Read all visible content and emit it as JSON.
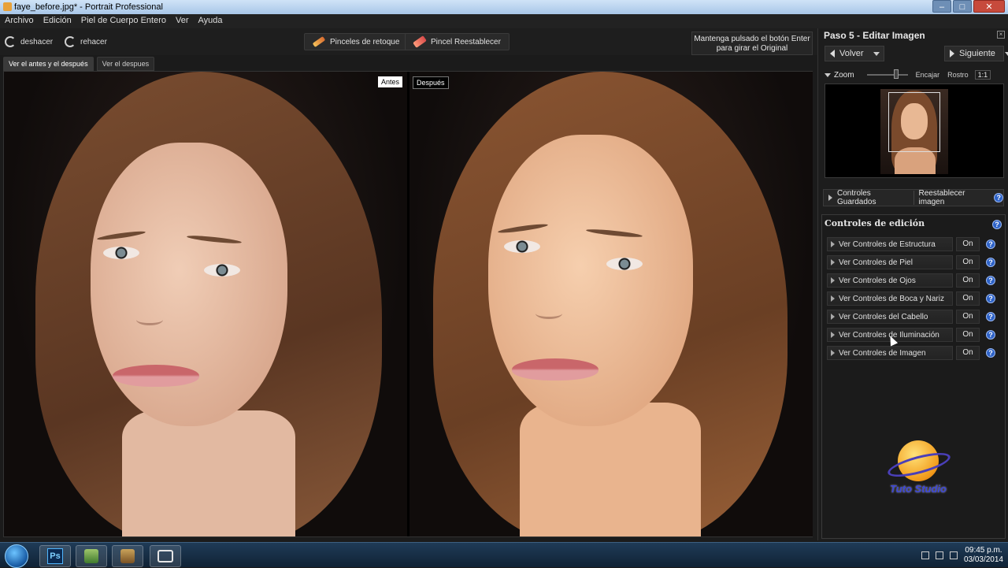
{
  "window": {
    "title": "faye_before.jpg* - Portrait Professional"
  },
  "menu": [
    "Archivo",
    "Edición",
    "Piel de Cuerpo Entero",
    "Ver",
    "Ayuda"
  ],
  "toolbar": {
    "undo_label": "deshacer",
    "redo_label": "rehacer",
    "retouch_brushes_label": "Pinceles de retoque",
    "reset_brush_label": "Pincel Reestablecer",
    "hold_hint_line1": "Mantenga pulsado el botón Enter",
    "hold_hint_line2": "para girar el Original"
  },
  "view_tabs": [
    "Ver el antes y el después",
    "Ver el despues"
  ],
  "image_labels": {
    "before": "Antes",
    "after": "Después"
  },
  "panel": {
    "title": "Paso 5 - Editar Imagen",
    "back_label": "Volver",
    "next_label": "Siguiente",
    "zoom_label": "Zoom",
    "zoom_fit": "Encajar",
    "zoom_face": "Rostro",
    "zoom_ratio": "1:1",
    "saved_controls_label": "Controles Guardados",
    "reset_image_label": "Reestablecer imagen",
    "edit_controls_title": "Controles de edición",
    "controls": [
      {
        "label": "Ver Controles de Estructura",
        "state": "On"
      },
      {
        "label": "Ver Controles de Piel",
        "state": "On"
      },
      {
        "label": "Ver Controles de Ojos",
        "state": "On"
      },
      {
        "label": "Ver Controles de Boca y Nariz",
        "state": "On"
      },
      {
        "label": "Ver Controles del Cabello",
        "state": "On"
      },
      {
        "label": "Ver Controles de Iluminación",
        "state": "On"
      },
      {
        "label": "Ver Controles de Imagen",
        "state": "On"
      }
    ],
    "help_glyph": "?"
  },
  "logo_text": "Tuto Studio",
  "taskbar": {
    "apps": [
      "photoshop-icon",
      "app-icon-green",
      "app-icon-portrait",
      "app-icon-window"
    ],
    "time": "09:45 p.m.",
    "date": "03/03/2014"
  },
  "colors": {
    "accent_help": "#2d62c8",
    "panel_bg": "#1d1d1d",
    "logo_blue": "#3b46d6"
  }
}
